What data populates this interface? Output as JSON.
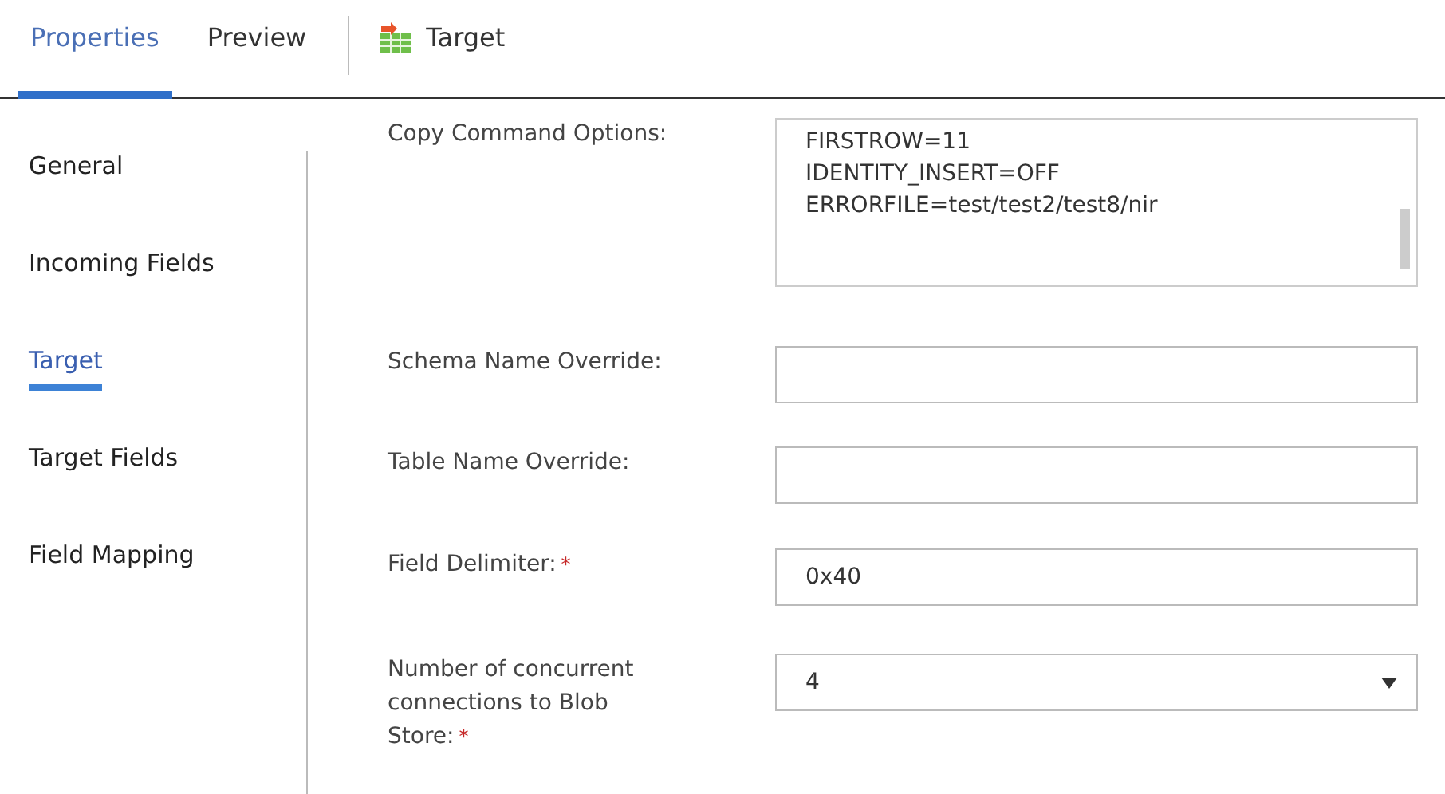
{
  "tabs": [
    {
      "label": "Properties",
      "selected": true
    },
    {
      "label": "Preview",
      "selected": false
    }
  ],
  "object": {
    "label": "Target"
  },
  "sidebar": {
    "items": [
      {
        "label": "General",
        "selected": false
      },
      {
        "label": "Incoming Fields",
        "selected": false
      },
      {
        "label": "Target",
        "selected": true
      },
      {
        "label": "Target Fields",
        "selected": false
      },
      {
        "label": "Field Mapping",
        "selected": false
      }
    ]
  },
  "fields": [
    {
      "kind": "textarea",
      "label": "Copy Command Options:",
      "value": "FIRSTROW=11\nIDENTITY_INSERT=OFF\nERRORFILE=test/test2/test8/nir"
    },
    {
      "kind": "text",
      "label": "Schema Name Override:"
    },
    {
      "kind": "text",
      "label": "Table Name Override:"
    },
    {
      "kind": "text",
      "label": "Field Delimiter:",
      "required_mark": "*",
      "value": "0x40"
    },
    {
      "kind": "select",
      "label": "Number of concurrent connections to Blob Store:",
      "required_mark": "*",
      "value": "4"
    }
  ]
}
